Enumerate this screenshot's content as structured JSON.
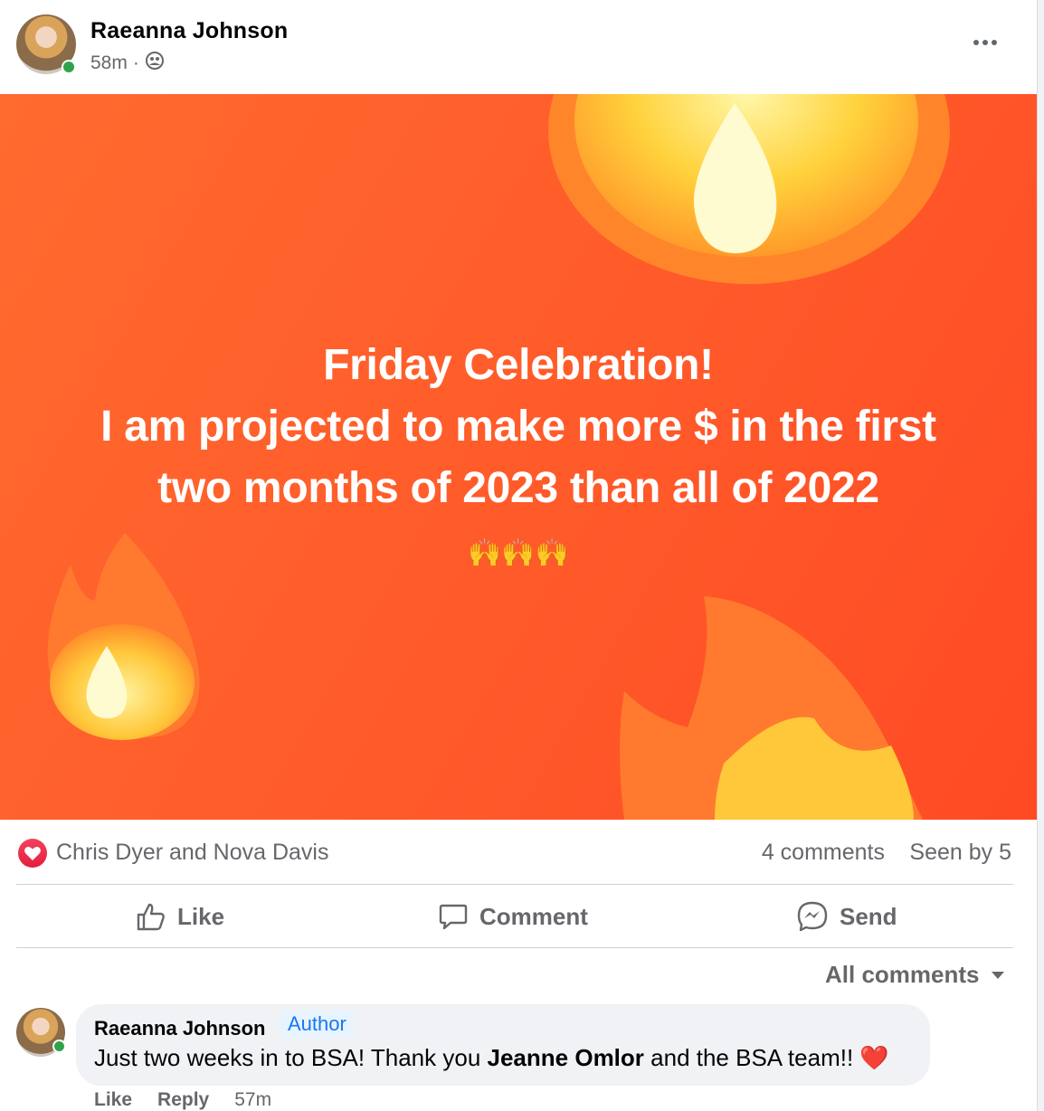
{
  "post": {
    "author": "Raeanna Johnson",
    "time": "58m",
    "separator": "·",
    "audience_icon": "group-icon",
    "more_icon": "more-horizontal-icon"
  },
  "banner": {
    "line1": "Friday Celebration!",
    "line2": "I am projected to make more $ in the first",
    "line3": "two months of 2023 than all of 2022",
    "emojis": "🙌🙌🙌",
    "background_color": "#ff5a2a"
  },
  "reactions": {
    "icon": "heart-icon",
    "names": "Chris Dyer and Nova Davis",
    "comments": "4 comments",
    "seen": "Seen by 5"
  },
  "actions": {
    "like": "Like",
    "comment": "Comment",
    "send": "Send"
  },
  "comments_sort": "All comments",
  "comment": {
    "author": "Raeanna Johnson",
    "badge": "Author",
    "text_before": "Just two weeks in to BSA! Thank you ",
    "mention": "Jeanne Omlor",
    "text_after": " and the BSA team!! ",
    "emoji": "❤️",
    "like": "Like",
    "reply": "Reply",
    "time": "57m"
  },
  "colors": {
    "accent": "#1877f2",
    "online": "#31a24c",
    "heart": "#e41e3f"
  }
}
